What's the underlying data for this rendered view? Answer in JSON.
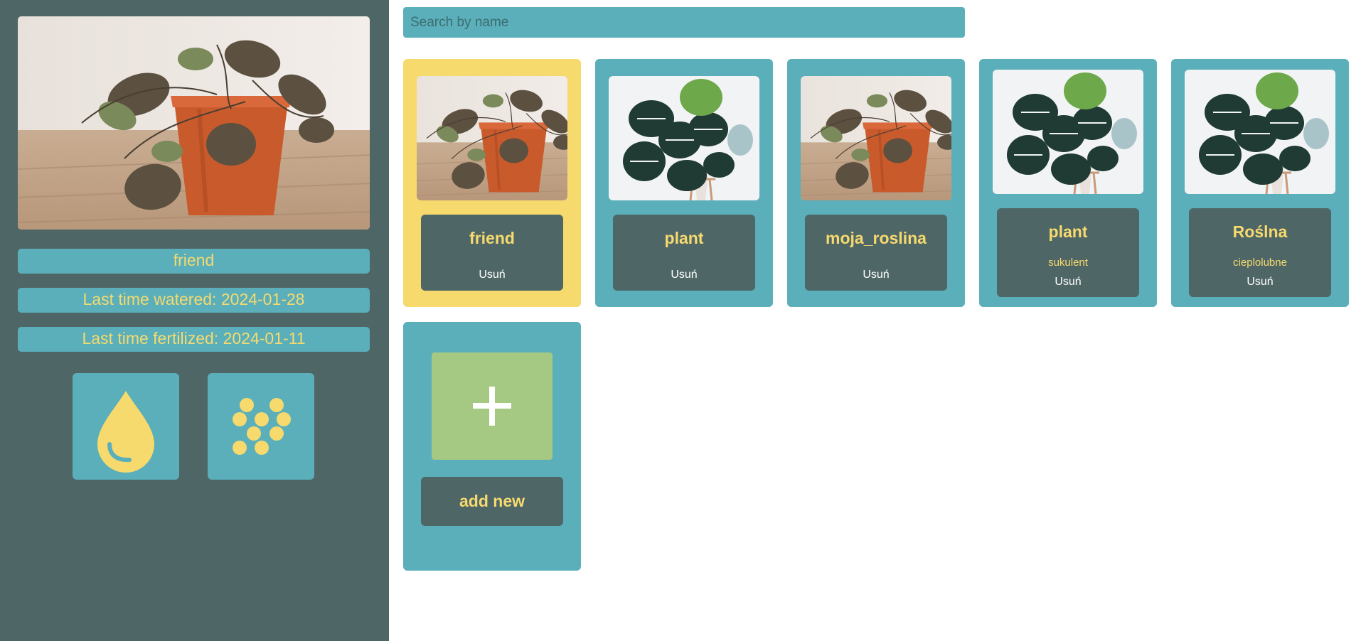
{
  "details": {
    "name": "friend",
    "watered": "Last time watered: 2024-01-28",
    "fertilized": "Last time fertilized: 2024-01-11",
    "water_icon": "water-drop-icon",
    "fertilize_icon": "fertilizer-dots-icon"
  },
  "search": {
    "placeholder": "Search by name",
    "value": ""
  },
  "plants": [
    {
      "name": "friend",
      "subtitle": "",
      "delete_label": "Usuń",
      "image": "wilted-plant",
      "selected": true
    },
    {
      "name": "plant",
      "subtitle": "",
      "delete_label": "Usuń",
      "image": "monstera",
      "selected": false
    },
    {
      "name": "moja_roslina",
      "subtitle": "",
      "delete_label": "Usuń",
      "image": "wilted-plant",
      "selected": false
    },
    {
      "name": "plant",
      "subtitle": "sukulent",
      "delete_label": "Usuń",
      "image": "monstera",
      "selected": false
    },
    {
      "name": "Roślna",
      "subtitle": "cieplolubne",
      "delete_label": "Usuń",
      "image": "monstera",
      "selected": false
    }
  ],
  "add": {
    "plus_icon": "plus-icon",
    "label": "add new"
  },
  "colors": {
    "sidebar": "#4f6666",
    "teal": "#5aafba",
    "yellow": "#f6da6e",
    "green": "#a5c883"
  }
}
